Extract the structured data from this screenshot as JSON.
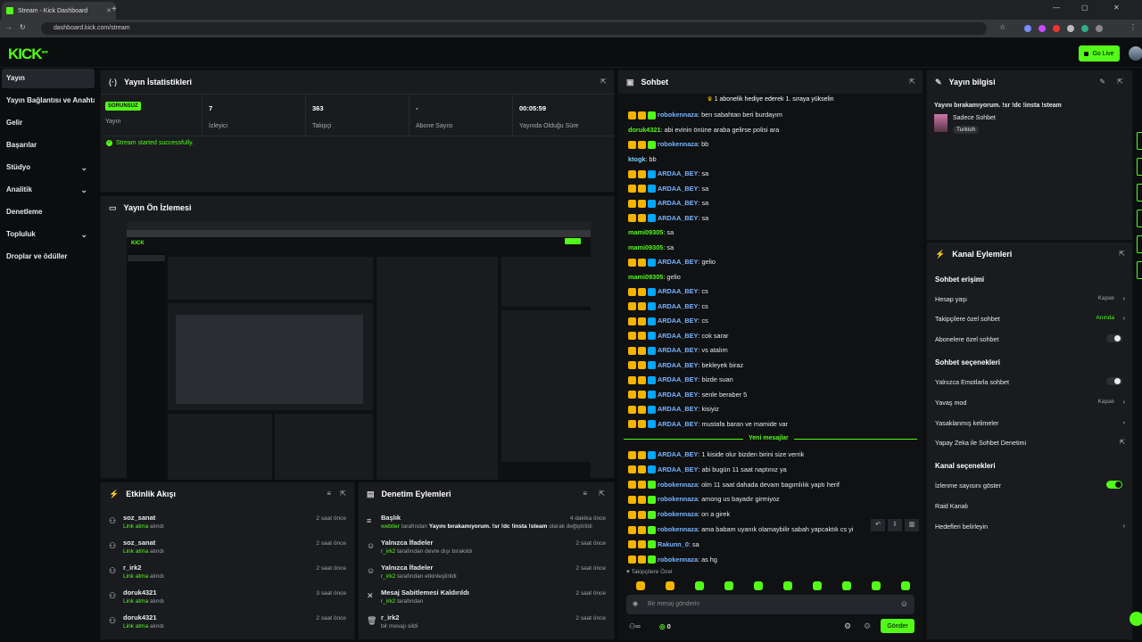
{
  "browser": {
    "tab_title": "Stream - Kick Dashboard",
    "url": "dashboard.kick.com/stream"
  },
  "header": {
    "logo": "KICK",
    "logo_sup": "BETA",
    "go_live": "Go Live"
  },
  "sidebar": {
    "items": [
      {
        "label": "Yayın",
        "active": true
      },
      {
        "label": "Yayın Bağlantısı ve Anahtarı"
      },
      {
        "label": "Gelir"
      },
      {
        "label": "Başarılar"
      },
      {
        "label": "Stüdyo",
        "expand": true
      },
      {
        "label": "Analitik",
        "expand": true
      },
      {
        "label": "Denetleme"
      },
      {
        "label": "Topluluk",
        "expand": true
      },
      {
        "label": "Droplar ve ödüller"
      }
    ]
  },
  "stats": {
    "title": "Yayın İstatistikleri",
    "status": "SORUNSUZ",
    "status_label": "Yayın",
    "cells": [
      {
        "value": "7",
        "label": "İzleyici"
      },
      {
        "value": "363",
        "label": "Takipçi"
      },
      {
        "value": "-",
        "label": "Abone Sayısı"
      },
      {
        "value": "00:05:59",
        "label": "Yayında Olduğu Süre"
      }
    ],
    "toast": "Stream started successfully."
  },
  "preview": {
    "title": "Yayın Ön İzlemesi"
  },
  "activity": {
    "title": "Etkinlik Akışı",
    "rows": [
      {
        "name": "soz_sanat",
        "sub_action": "Link atma",
        "sub_rest": " alındı",
        "time": "2 saat önce"
      },
      {
        "name": "soz_sanat",
        "sub_action": "Link atma",
        "sub_rest": " alındı",
        "time": "2 saat önce"
      },
      {
        "name": "r_irk2",
        "sub_action": "Link atma",
        "sub_rest": " alındı",
        "time": "2 saat önce"
      },
      {
        "name": "doruk4321",
        "sub_action": "Link atma",
        "sub_rest": " alındı",
        "time": "3 saat önce"
      },
      {
        "name": "doruk4321",
        "sub_action": "Link atma",
        "sub_rest": " alındı",
        "time": "2 saat önce"
      }
    ]
  },
  "modlog": {
    "title": "Denetim Eylemleri",
    "rows": [
      {
        "icon": "≡",
        "name": "Başlık",
        "who": "webtier",
        "mid": " tarafından ",
        "what": "Yayını bırakamıyorum. !sr !dc !insta !steam",
        "end": " olarak değiştirildi",
        "time": "4 dakika önce"
      },
      {
        "icon": "☺",
        "name": "Yalnızca İfadeler",
        "who": "r_irk2",
        "mid": " tarafından devre dışı bırakıldı",
        "what": "",
        "end": "",
        "time": "2 saat önce"
      },
      {
        "icon": "☺",
        "name": "Yalnızca İfadeler",
        "who": "r_irk2",
        "mid": " tarafından etkinleştirildi",
        "what": "",
        "end": "",
        "time": "2 saat önce"
      },
      {
        "icon": "✕",
        "name": "Mesaj Sabitlemesi Kaldırıldı",
        "who": "r_irk2",
        "mid": " tarafından",
        "what": "",
        "end": "",
        "time": "2 saat önce"
      },
      {
        "icon": "🗑",
        "name": "r_irk2",
        "who": "",
        "mid": "bir mesajı sildi",
        "what": "",
        "end": "",
        "time": "2 saat önce"
      }
    ]
  },
  "chat": {
    "title": "Sohbet",
    "banner": "1 abonelik hediye ederek 1. sıraya yükselin",
    "new_messages": "Yeni mesajlar",
    "messages": [
      {
        "user": "robokennaza",
        "text": "ben sabahtan beri burdayım",
        "type": "rob"
      },
      {
        "user": "doruk4321",
        "text": "abi evinin önüne araba gelirse polisi ara",
        "type": "gn"
      },
      {
        "user": "robokennaza",
        "text": "bb",
        "type": "rob"
      },
      {
        "user": "ktogk",
        "text": "bb",
        "type": "plain"
      },
      {
        "user": "ARDAA_BEY",
        "text": "sa",
        "type": "ard"
      },
      {
        "user": "ARDAA_BEY",
        "text": "sa",
        "type": "ard"
      },
      {
        "user": "ARDAA_BEY",
        "text": "sa",
        "type": "ard"
      },
      {
        "user": "ARDAA_BEY",
        "text": "sa",
        "type": "ard"
      },
      {
        "user": "mami09305",
        "text": "sa",
        "type": "gn"
      },
      {
        "user": "mami09305",
        "text": "sa",
        "type": "gn"
      },
      {
        "user": "ARDAA_BEY",
        "text": "gelio",
        "type": "ard"
      },
      {
        "user": "mami09305",
        "text": "gelio",
        "type": "gn"
      },
      {
        "user": "ARDAA_BEY",
        "text": "cs",
        "type": "ard"
      },
      {
        "user": "ARDAA_BEY",
        "text": "cs",
        "type": "ard"
      },
      {
        "user": "ARDAA_BEY",
        "text": "cs",
        "type": "ard"
      },
      {
        "user": "ARDAA_BEY",
        "text": "cok sarar",
        "type": "ard"
      },
      {
        "user": "ARDAA_BEY",
        "text": "vs atalım",
        "type": "ard"
      },
      {
        "user": "ARDAA_BEY",
        "text": "bekleyek biraz",
        "type": "ard"
      },
      {
        "user": "ARDAA_BEY",
        "text": "bizde suan",
        "type": "ard"
      },
      {
        "user": "ARDAA_BEY",
        "text": "senle beraber 5",
        "type": "ard"
      },
      {
        "user": "ARDAA_BEY",
        "text": "kisiyiz",
        "type": "ard"
      },
      {
        "user": "ARDAA_BEY",
        "text": "mustafa baran ve mamide var",
        "type": "ard"
      }
    ],
    "new": [
      {
        "user": "ARDAA_BEY",
        "text": "1 kiside olur bizden birini size verrik",
        "type": "ard"
      },
      {
        "user": "ARDAA_BEY",
        "text": "abi bugün 11 saat naptınız ya",
        "type": "ard"
      },
      {
        "user": "robokennaza",
        "text": "olm 11 saat dahada devam bagımlılık yaptı herif",
        "type": "rob"
      },
      {
        "user": "robokennaza",
        "text": "among us bayadır girmiyoz",
        "type": "rob"
      },
      {
        "user": "robokennaza",
        "text": "on a girek",
        "type": "rob"
      },
      {
        "user": "robokennaza",
        "text": "ama babam uyanık olamaybilir sabah yapcaktık cs yi",
        "type": "rob"
      },
      {
        "user": "Rakunn_0",
        "text": "sa",
        "type": "rob"
      },
      {
        "user": "robokennaza",
        "text": "as hg",
        "type": "rob"
      }
    ],
    "followers_only": "Takipçilere Özel",
    "input_placeholder": "Bir mesaj gönderin",
    "points": "0",
    "send": "Gönder"
  },
  "info": {
    "title": "Yayın bilgisi",
    "stream_title": "Yayını bırakamıyorum. !sr !dc !insta !steam",
    "category": "Sadece Sohbet",
    "tag": "Turkish"
  },
  "actions": {
    "title": "Kanal Eylemleri",
    "sections": [
      {
        "heading": "Sohbet erişimi",
        "rows": [
          {
            "label": "Hesap yaşı",
            "value": "Kapalı",
            "kind": "arrow"
          },
          {
            "label": "Takipçilere özel sohbet",
            "value": "Anında",
            "kind": "arrow",
            "green": true
          },
          {
            "label": "Abonelere özel sohbet",
            "value": "",
            "kind": "toggle"
          }
        ]
      },
      {
        "heading": "Sohbet seçenekleri",
        "rows": [
          {
            "label": "Yalnızca Emotlarla sohbet",
            "value": "",
            "kind": "toggle"
          },
          {
            "label": "Yavaş mod",
            "value": "Kapalı",
            "kind": "arrow"
          },
          {
            "label": "Yasaklanmış kelimeler",
            "value": "",
            "kind": "arrow"
          },
          {
            "label": "Yapay Zeka ile Sohbet Denetimi",
            "value": "",
            "kind": "ext"
          }
        ]
      },
      {
        "heading": "Kanal seçenekleri",
        "rows": [
          {
            "label": "İzlenme sayısını göster",
            "value": "",
            "kind": "toggle-on"
          },
          {
            "label": "Raid Kanalı",
            "value": "",
            "kind": "none"
          },
          {
            "label": "Hedefleri belirleyin",
            "value": "",
            "kind": "arrow"
          }
        ]
      }
    ]
  },
  "colors": {
    "accent": "#53fc18",
    "panel": "#191b1f",
    "bg": "#0b0e0f",
    "link": "#78b4ff"
  }
}
